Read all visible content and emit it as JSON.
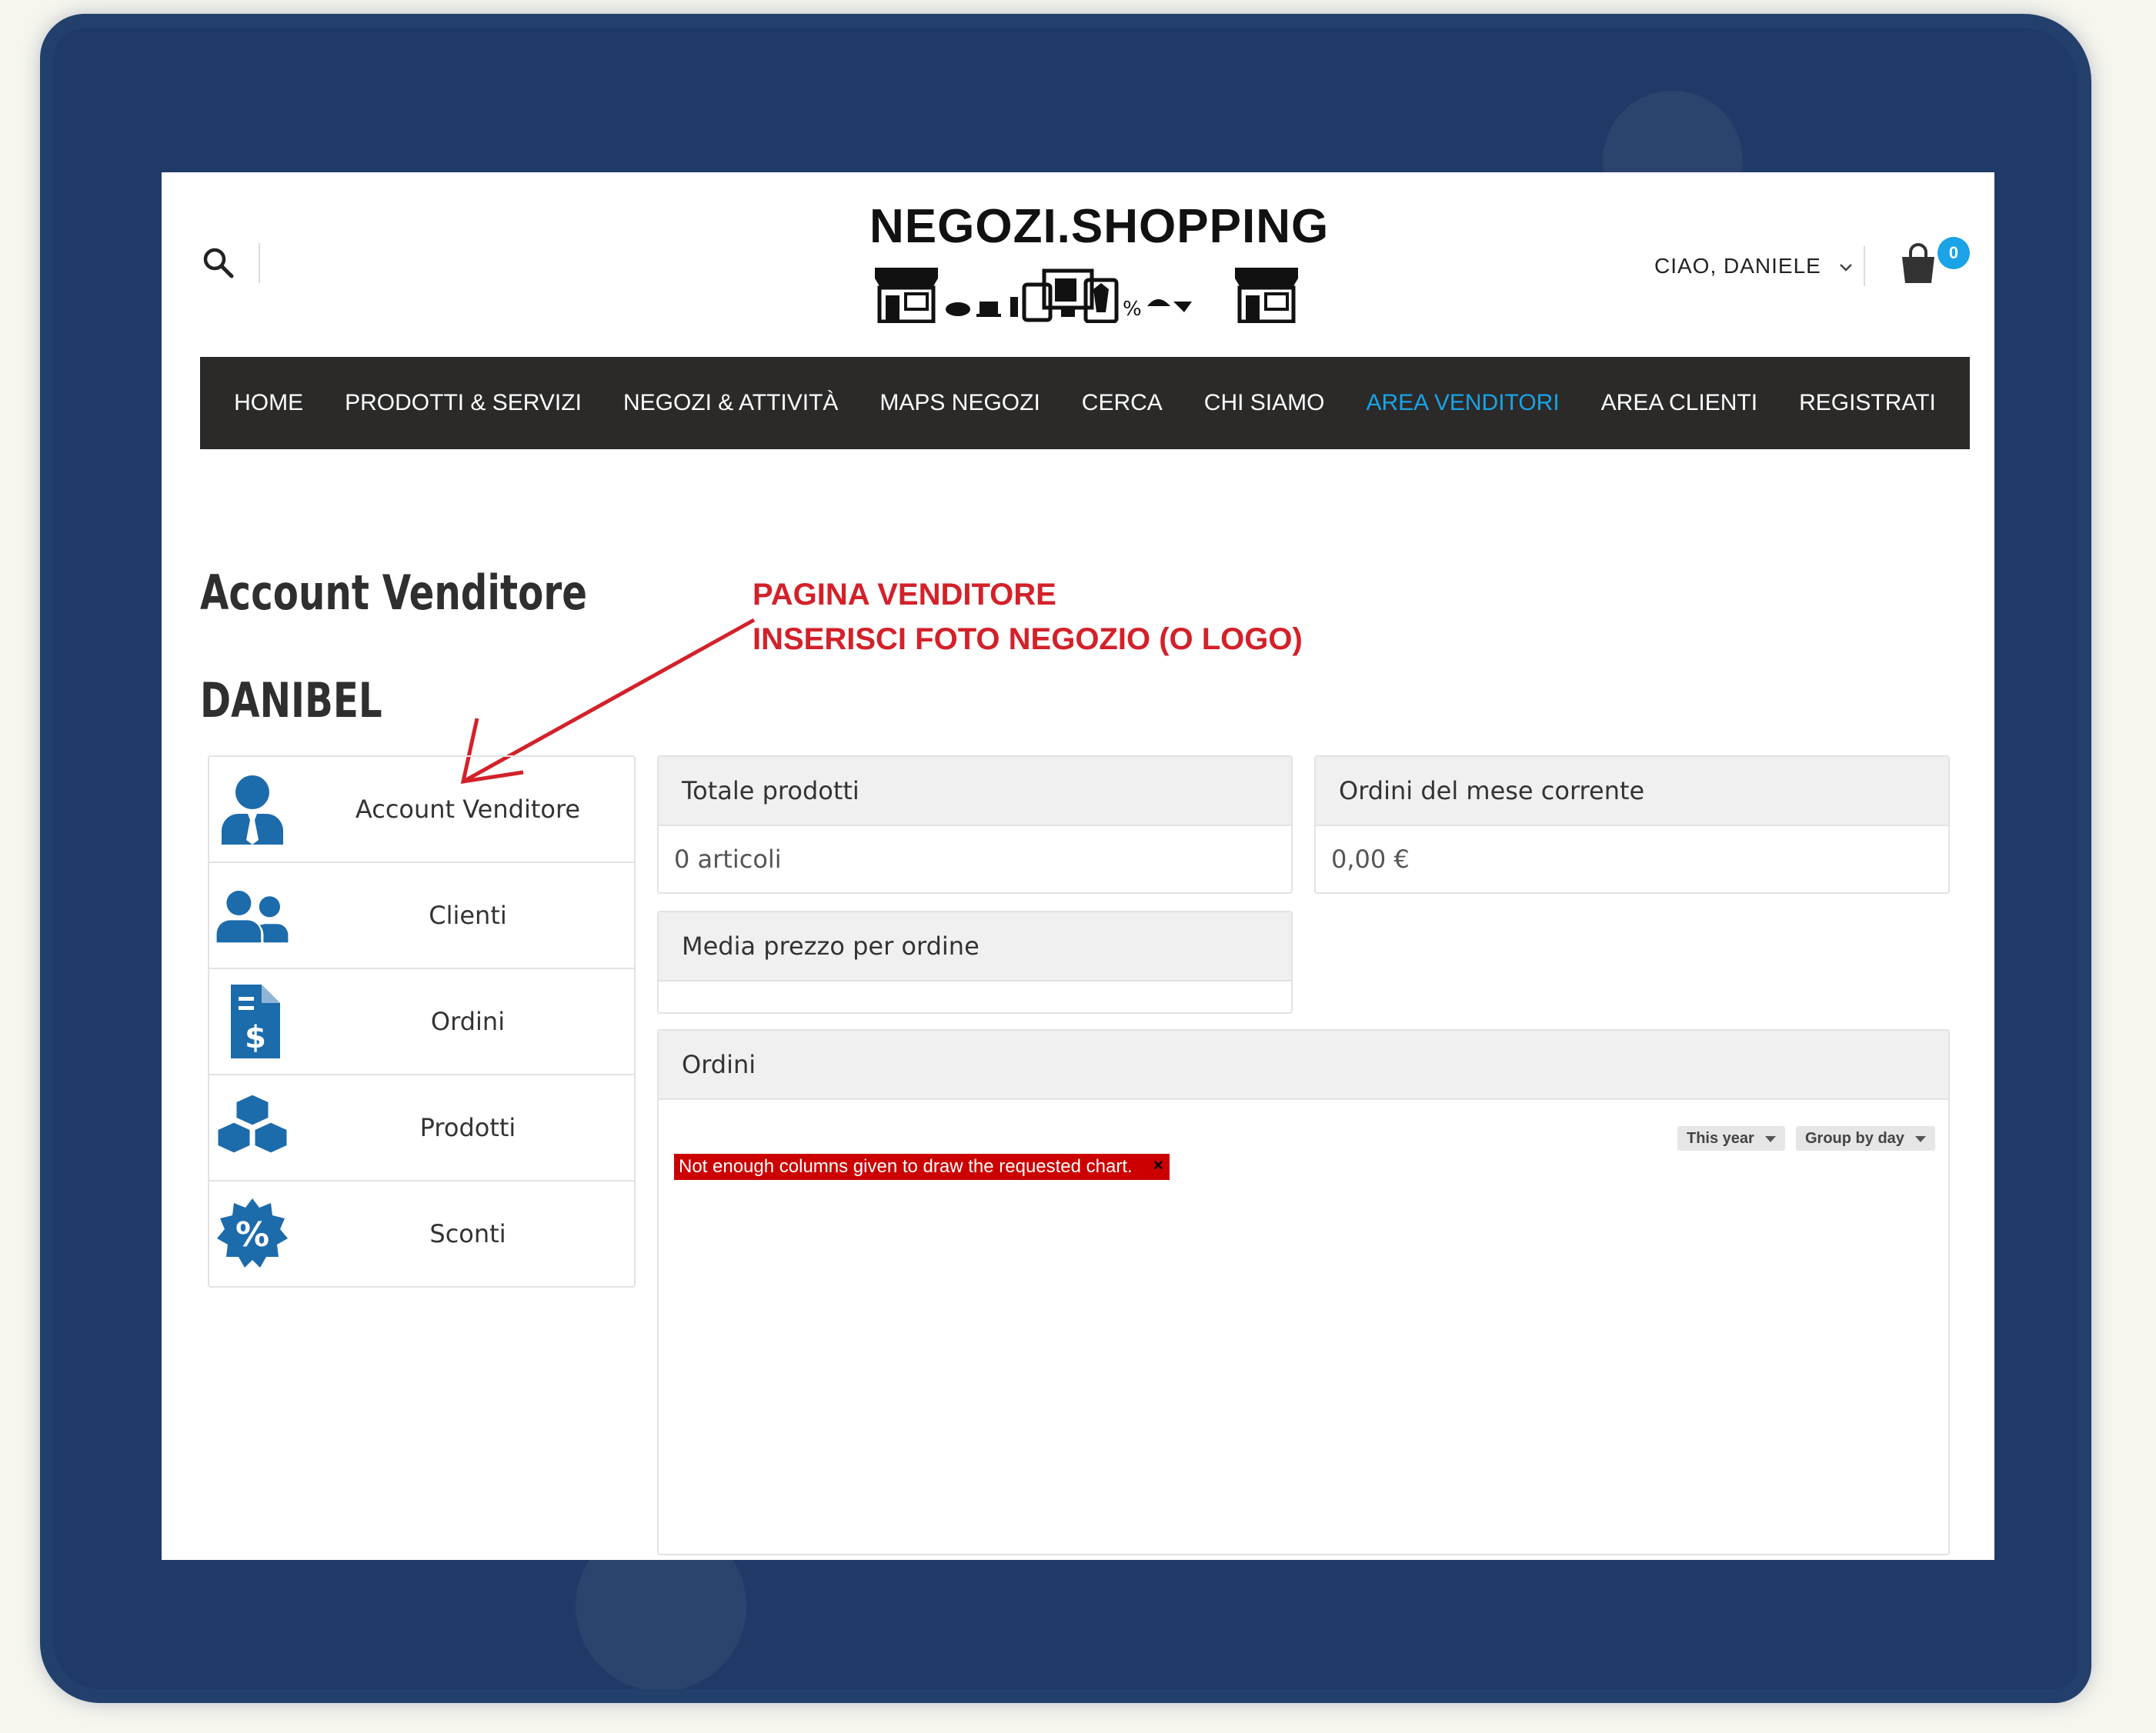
{
  "header": {
    "logo_text": "NEGOZI.SHOPPING",
    "greeting": "CIAO, DANIELE",
    "cart_count": "0"
  },
  "nav": {
    "items": [
      {
        "label": "HOME"
      },
      {
        "label": "PRODOTTI & SERVIZI"
      },
      {
        "label": "NEGOZI & ATTIVITÀ"
      },
      {
        "label": "MAPS NEGOZI"
      },
      {
        "label": "CERCA"
      },
      {
        "label": "CHI SIAMO"
      },
      {
        "label": "AREA VENDITORI",
        "active": true
      },
      {
        "label": "AREA CLIENTI"
      },
      {
        "label": "REGISTRATI"
      }
    ]
  },
  "main": {
    "title": "Account Venditore",
    "shop_name": "DANIBEL"
  },
  "annotation": {
    "line1": "PAGINA VENDITORE",
    "line2": "INSERISCI FOTO NEGOZIO (O LOGO)",
    "color": "#d3212a"
  },
  "sidebar": {
    "items": [
      {
        "label": "Account Venditore",
        "icon": "user-tie-icon"
      },
      {
        "label": "Clienti",
        "icon": "users-icon"
      },
      {
        "label": "Ordini",
        "icon": "invoice-dollar-icon"
      },
      {
        "label": "Prodotti",
        "icon": "boxes-icon"
      },
      {
        "label": "Sconti",
        "icon": "percent-badge-icon"
      }
    ]
  },
  "panels": {
    "totale_prodotti": {
      "title": "Totale prodotti",
      "value": "0 articoli"
    },
    "ordini_mese": {
      "title": "Ordini del mese corrente",
      "value": "0,00 €"
    },
    "media_prezzo": {
      "title": "Media prezzo per ordine",
      "value": ""
    },
    "ordini": {
      "title": "Ordini",
      "range_select": "This year",
      "group_select": "Group by day",
      "error": "Not enough columns given to draw the requested chart.",
      "error_close": "×"
    }
  },
  "colors": {
    "accent": "#1aa3e6",
    "nav_bg": "#2b2a29",
    "icon_blue": "#1c6bab",
    "error_red": "#cc0000",
    "frame": "#1f3a66"
  }
}
